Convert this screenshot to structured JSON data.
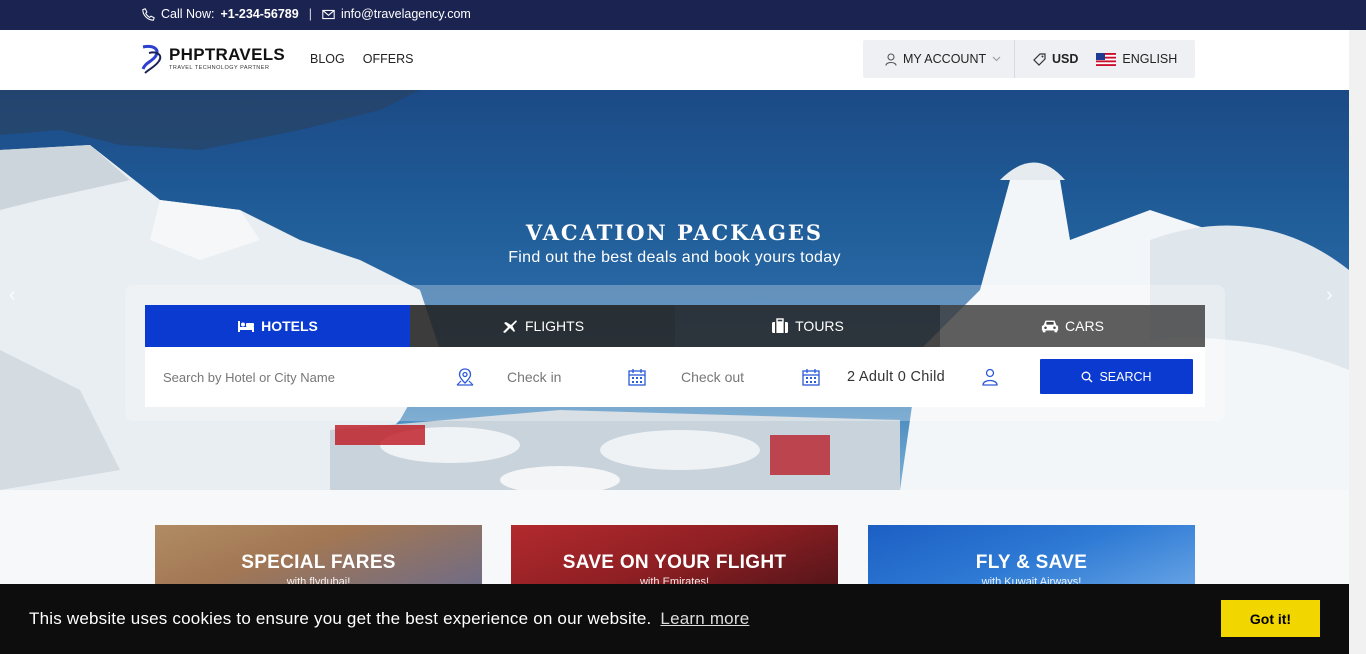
{
  "topbar": {
    "call_label": "Call Now:",
    "phone": "+1-234-56789",
    "separator": "|",
    "email": "info@travelagency.com"
  },
  "header": {
    "logo_title": "PHPTRAVELS",
    "logo_tagline": "TRAVEL TECHNOLOGY PARTNER",
    "nav": [
      "BLOG",
      "OFFERS"
    ],
    "account_label": "MY ACCOUNT",
    "currency": "USD",
    "language": "ENGLISH"
  },
  "hero": {
    "title": "VACATION PACKAGES",
    "subtitle": "Find out the best deals and book yours today"
  },
  "search": {
    "tabs": [
      {
        "label": "HOTELS",
        "icon": "bed-icon",
        "active": true
      },
      {
        "label": "FLIGHTS",
        "icon": "plane-icon",
        "active": false
      },
      {
        "label": "TOURS",
        "icon": "suitcase-icon",
        "active": false
      },
      {
        "label": "CARS",
        "icon": "car-icon",
        "active": false
      }
    ],
    "placeholder": "Search by Hotel or City Name",
    "checkin": "Check in",
    "checkout": "Check out",
    "guests": "2 Adult 0 Child",
    "button": "SEARCH"
  },
  "promos": [
    {
      "title": "SPECIAL FARES",
      "subtitle": "with flydubai!"
    },
    {
      "title": "SAVE ON YOUR FLIGHT",
      "subtitle": "with Emirates!"
    },
    {
      "title": "FLY & SAVE",
      "subtitle": "with Kuwait Airways!"
    }
  ],
  "cookie": {
    "message": "This website uses cookies to ensure you get the best experience on our website.",
    "link": "Learn more",
    "button": "Got it!"
  },
  "colors": {
    "topbar": "#1b2450",
    "accent_blue": "#0a3ad0",
    "cookie_button": "#f1d600"
  }
}
